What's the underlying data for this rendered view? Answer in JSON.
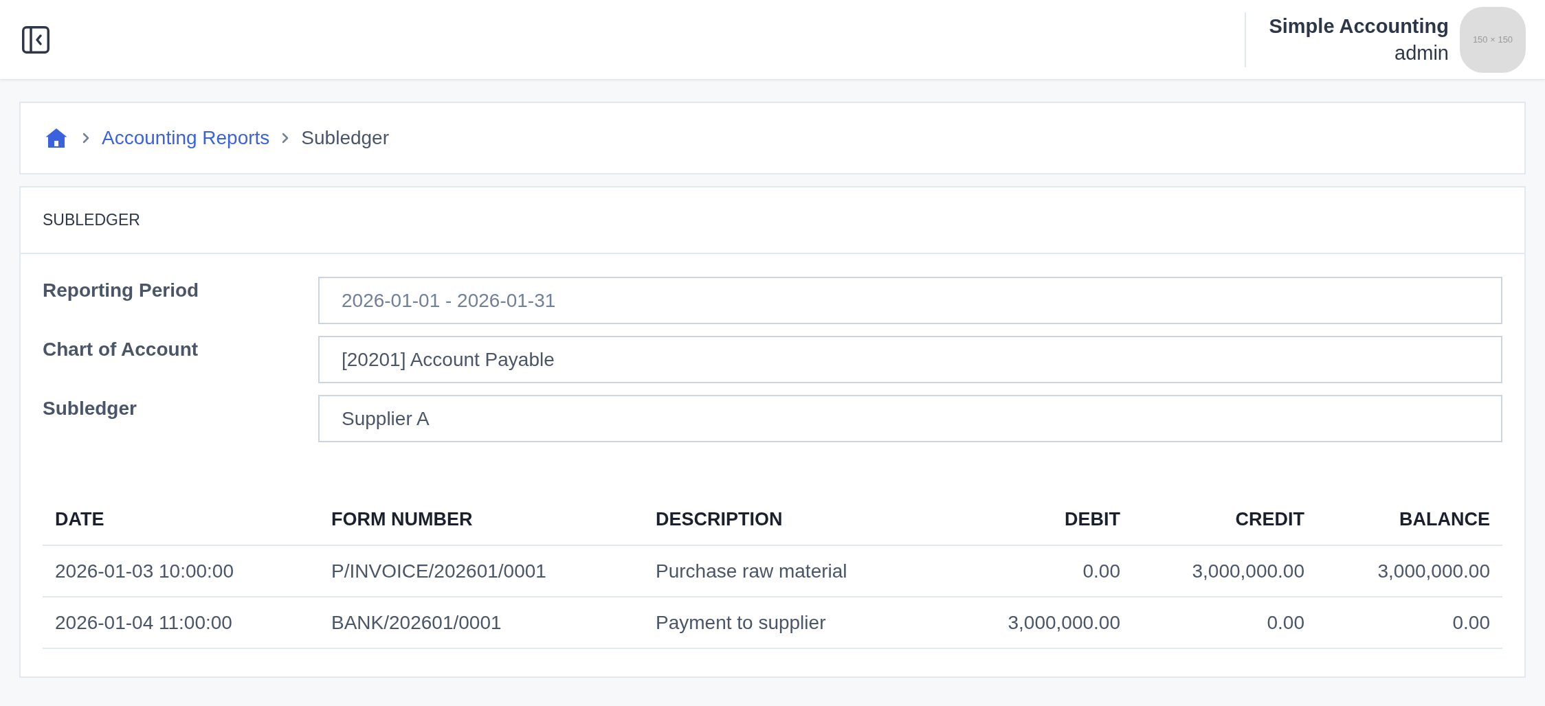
{
  "header": {
    "app_name": "Simple Accounting",
    "user": "admin",
    "avatar_text": "150 × 150"
  },
  "breadcrumb": [
    {
      "kind": "link",
      "label": "Accounting Reports"
    },
    {
      "kind": "current",
      "label": "Subledger"
    }
  ],
  "report": {
    "title": "SUBLEDGER",
    "fields": [
      {
        "label": "Reporting Period",
        "placeholder": "2026-01-01 - 2026-01-31"
      },
      {
        "label": "Chart of Account",
        "value": "[20201] Account Payable"
      },
      {
        "label": "Subledger",
        "value": "Supplier A"
      }
    ],
    "table": {
      "columns": [
        {
          "label": "DATE",
          "numeric": false
        },
        {
          "label": "FORM NUMBER",
          "numeric": false
        },
        {
          "label": "DESCRIPTION",
          "numeric": false
        },
        {
          "label": "DEBIT",
          "numeric": true
        },
        {
          "label": "CREDIT",
          "numeric": true
        },
        {
          "label": "BALANCE",
          "numeric": true
        }
      ],
      "rows": [
        {
          "cells": [
            "2026-01-03 10:00:00",
            "P/INVOICE/202601/0001",
            "Purchase raw material",
            "0.00",
            "3,000,000.00",
            "3,000,000.00"
          ]
        },
        {
          "cells": [
            "2026-01-04 11:00:00",
            "BANK/202601/0001",
            "Payment to supplier",
            "3,000,000.00",
            "0.00",
            "0.00"
          ]
        }
      ]
    }
  }
}
